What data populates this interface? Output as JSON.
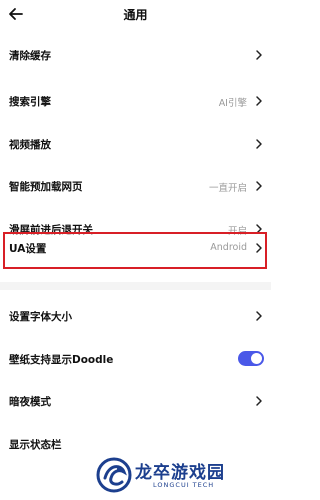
{
  "header": {
    "title": "通用",
    "back_icon": "arrow-left-icon"
  },
  "rows": [
    {
      "label": "清除缓存",
      "value": ""
    },
    {
      "label": "搜索引擎",
      "value": "AI引擎"
    },
    {
      "label": "视频播放",
      "value": ""
    },
    {
      "label": "智能预加载网页",
      "value": "一直开启"
    },
    {
      "label": "滑屏前进后退开关",
      "value": "开启"
    },
    {
      "label": "UA设置",
      "value": "Android"
    },
    {
      "label": "设置字体大小",
      "value": ""
    },
    {
      "label": "壁纸支持显示Doodle",
      "value": "",
      "toggle": true
    },
    {
      "label": "暗夜模式",
      "value": ""
    },
    {
      "label": "显示状态栏",
      "value": ""
    }
  ],
  "toggle_color": "#4a58e8",
  "highlight_color": "#d81f26",
  "watermark": {
    "text": "龙卒游戏园",
    "sub": "LONGCUI TECH"
  }
}
